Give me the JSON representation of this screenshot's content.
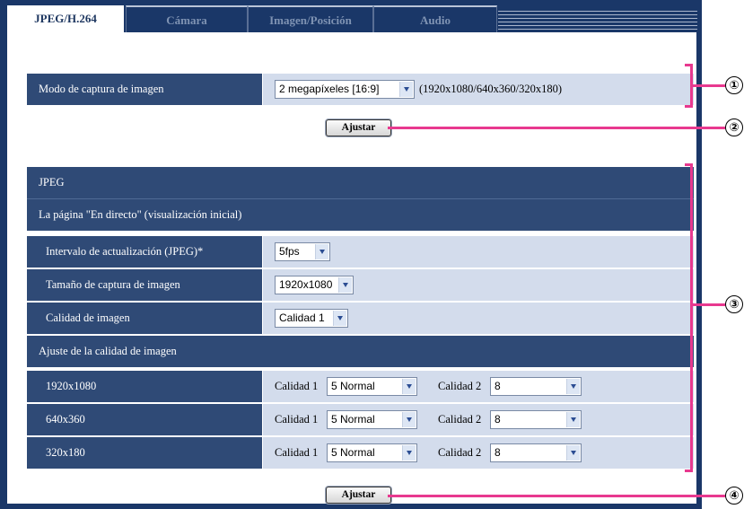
{
  "tabs": [
    "JPEG/H.264",
    "Cámara",
    "Imagen/Posición",
    "Audio"
  ],
  "capture_mode": {
    "label": "Modo de captura de imagen",
    "value": "2 megapíxeles [16:9]",
    "note": "(1920x1080/640x360/320x180)"
  },
  "set_button_1": "Ajustar",
  "jpeg": {
    "header": "JPEG",
    "live_header": "La página \"En directo\" (visualización inicial)",
    "refresh_label": "Intervalo de actualización (JPEG)*",
    "refresh_value": "5fps",
    "size_label": "Tamaño de captura de imagen",
    "size_value": "1920x1080",
    "quality_label": "Calidad de imagen",
    "quality_value": "Calidad 1",
    "quality_setting_header": "Ajuste de la calidad de imagen",
    "rows": [
      {
        "res": "1920x1080",
        "q1_label": "Calidad 1",
        "q1": "5 Normal",
        "q2_label": "Calidad 2",
        "q2": "8"
      },
      {
        "res": "640x360",
        "q1_label": "Calidad 1",
        "q1": "5 Normal",
        "q2_label": "Calidad 2",
        "q2": "8"
      },
      {
        "res": "320x180",
        "q1_label": "Calidad 1",
        "q1": "5 Normal",
        "q2_label": "Calidad 2",
        "q2": "8"
      }
    ]
  },
  "set_button_2": "Ajustar",
  "callouts": [
    "①",
    "②",
    "③",
    "④"
  ],
  "colors": {
    "panel": "#1a3768",
    "label_bg": "#2f4a76",
    "value_bg": "#d3dcec",
    "annotation": "#e8398f"
  }
}
